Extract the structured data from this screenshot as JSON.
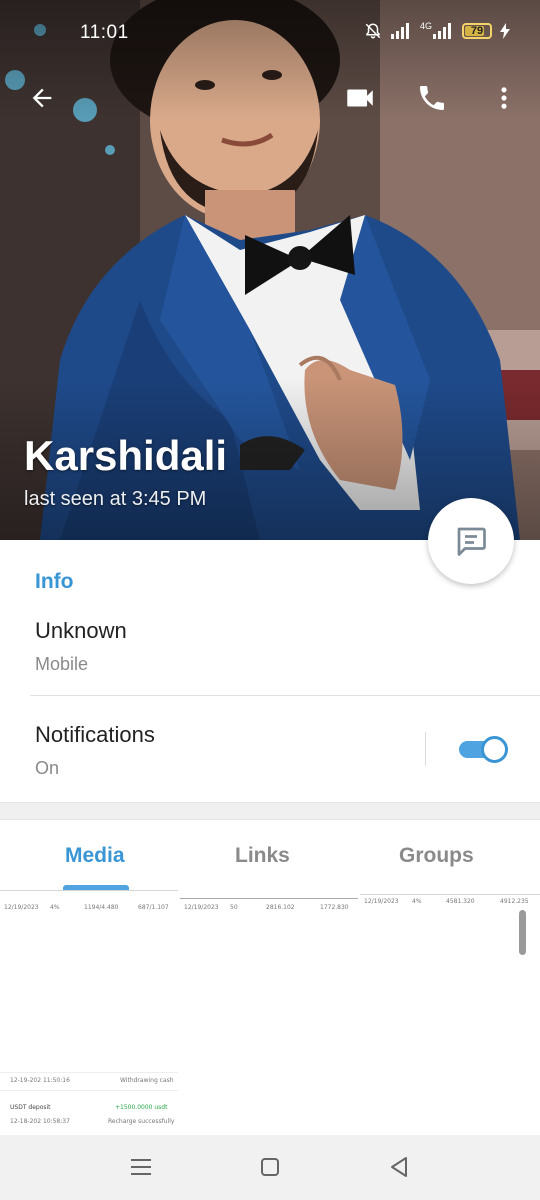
{
  "status_bar": {
    "time": "11:01",
    "network_label": "4G",
    "battery_level_percent": 79,
    "battery_text": "79"
  },
  "header": {
    "contact_name": "Karshidali",
    "last_seen": "last seen at 3:45 PM",
    "icons": [
      "back-arrow-icon",
      "video-call-icon",
      "phone-icon",
      "more-vert-icon",
      "message-icon"
    ]
  },
  "info": {
    "section_title": "Info",
    "phone": {
      "value": "Unknown",
      "label": "Mobile"
    },
    "notifications": {
      "title": "Notifications",
      "state": "On",
      "enabled": true
    }
  },
  "tabs": [
    {
      "label": "Media",
      "active": true
    },
    {
      "label": "Links",
      "active": false
    },
    {
      "label": "Groups",
      "active": false
    }
  ],
  "media_thumbs": [
    {
      "row": [
        "12/19/2023",
        "4%",
        "1194/4.480",
        "687/1.107"
      ]
    },
    {
      "row": [
        "12/19/2023",
        "50",
        "2816.102",
        "1772.830"
      ]
    },
    {
      "row": [
        "12/19/2023",
        "4%",
        "4581.320",
        "4912.235"
      ]
    }
  ],
  "transactions": [
    {
      "date": "12-19-202 11:50:16",
      "status": "Withdrawing cash"
    },
    {
      "title": "USDT deposit",
      "amount": "+1500.0000 usdt",
      "date": "12-18-202 10:58:37",
      "status": "Recharge successfully"
    }
  ],
  "colors": {
    "accent": "#3a95d5",
    "toggle_track": "#4fa3e0",
    "secondary_text": "#8a8a8a",
    "nav_bg": "#f1f1f1"
  }
}
